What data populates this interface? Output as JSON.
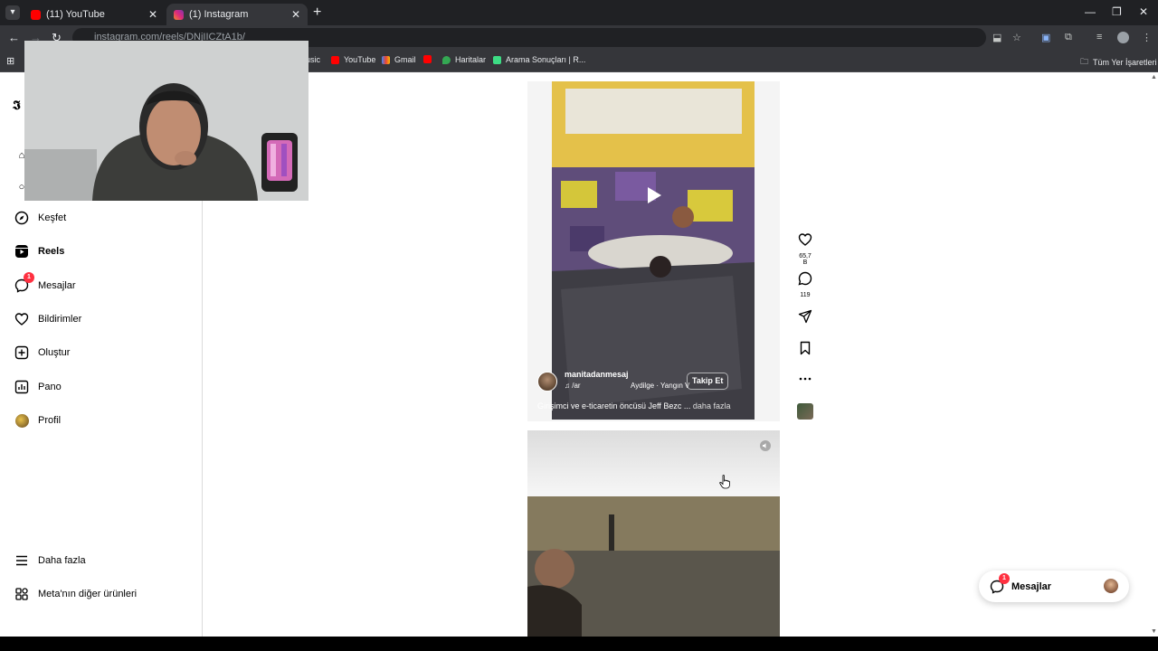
{
  "browser": {
    "tabs": [
      {
        "title": "(11) YouTube",
        "color": "#ff0000"
      },
      {
        "title": "(1) Instagram",
        "color": "#e1306c"
      }
    ],
    "url": "instagram.com/reels/DNjIICZtA1b/",
    "bookmarks": [
      {
        "label": "usic",
        "color": "#ff0000"
      },
      {
        "label": "YouTube",
        "color": "#ff0000"
      },
      {
        "label": "Gmail",
        "color": "#ea4335"
      },
      {
        "label": "",
        "color": "#ff0000"
      },
      {
        "label": "Haritalar",
        "color": "#34a853"
      },
      {
        "label": "Arama Sonuçları | R...",
        "color": "#3ddc84"
      }
    ],
    "all_bookmarks": "Tüm Yer İşaretleri"
  },
  "sidebar": {
    "items": [
      {
        "label": "Keşfet",
        "icon": "compass-icon"
      },
      {
        "label": "Reels",
        "icon": "reels-icon"
      },
      {
        "label": "Mesajlar",
        "icon": "messenger-icon",
        "badge": "1"
      },
      {
        "label": "Bildirimler",
        "icon": "heart-icon"
      },
      {
        "label": "Oluştur",
        "icon": "plus-square-icon"
      },
      {
        "label": "Pano",
        "icon": "dashboard-icon"
      },
      {
        "label": "Profil",
        "icon": "avatar"
      }
    ],
    "more": "Daha fazla",
    "meta": "Meta'nın diğer ürünleri"
  },
  "reel": {
    "username": "manitadanmesaj",
    "audio": "/ar",
    "song": "Aydilge · Yangın V",
    "follow": "Takip Et",
    "caption": "Girişimci ve e-ticaretin öncüsü Jeff Bezc ...",
    "more": "daha fazla",
    "likes": "65,7 B",
    "comments": "119"
  },
  "messages_pill": {
    "label": "Mesajlar",
    "badge": "1"
  }
}
